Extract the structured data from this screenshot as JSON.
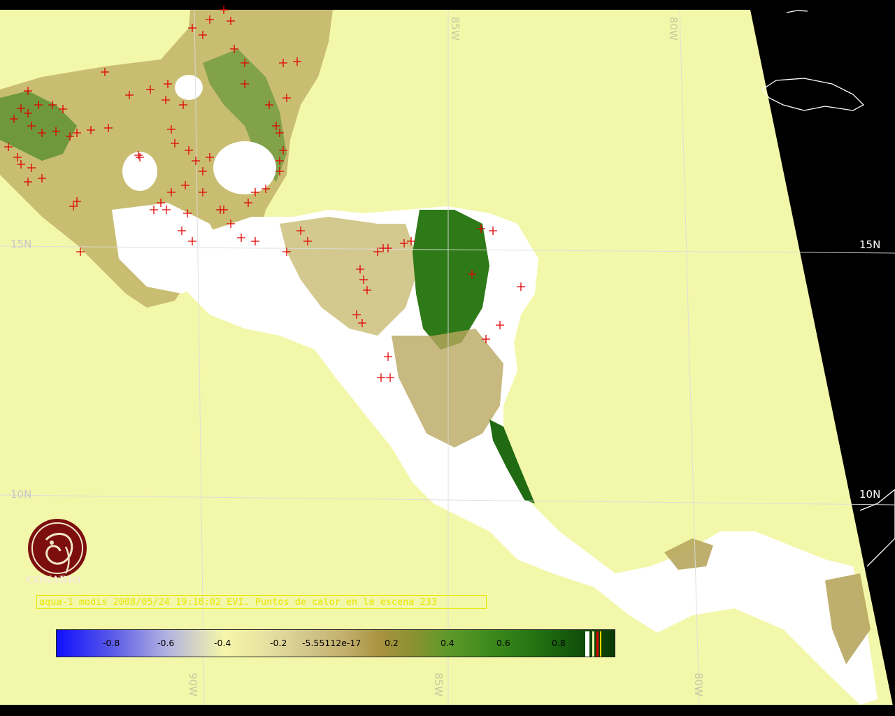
{
  "map": {
    "graticule_labels": {
      "lat_15_left": "15N",
      "lat_15_right": "15N",
      "lat_10_left": "10N",
      "lat_10_right": "10N",
      "lon_85_top": "85W",
      "lon_80_top": "80W",
      "lon_90_bottom": "90W",
      "lon_85_bottom": "85W",
      "lon_80_bottom": "80W"
    },
    "colors": {
      "ocean": "#f3f7aa",
      "space": "#000000",
      "cloud_land": "#ffffff",
      "fire_marker": "#e00000",
      "grid": "#d8d8d8",
      "coast": "#ffffff"
    }
  },
  "logo": {
    "name": "CONABIO",
    "icon": "conabio-emblem-icon"
  },
  "caption": "aqua-1 modis 2008/05/24 19:18:02 EVI. Puntos de calor en la escena 233",
  "legend": {
    "ticks": [
      "-0.8",
      "-0.6",
      "-0.4",
      "-0.2",
      "-5.55112e-17",
      "0.2",
      "0.4",
      "0.6",
      "0.8"
    ]
  }
}
